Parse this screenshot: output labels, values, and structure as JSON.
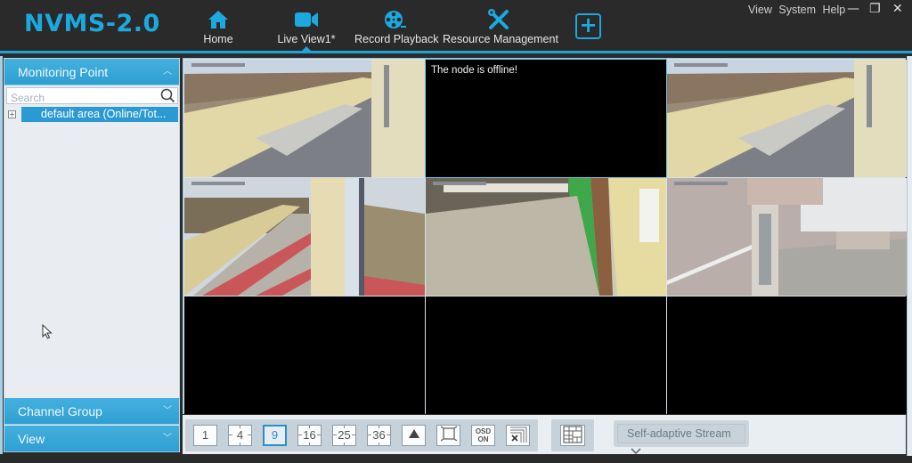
{
  "app": {
    "title": "NVMS-2.0",
    "accent_color": "#1ba9e0"
  },
  "nav": {
    "items": [
      {
        "label": "Home",
        "icon": "home-icon"
      },
      {
        "label": "Live View1*",
        "icon": "video-camera-icon",
        "active": true
      },
      {
        "label": "Record Playback",
        "icon": "film-reel-icon"
      },
      {
        "label": "Resource Management",
        "icon": "tools-icon"
      }
    ],
    "add_label": "+"
  },
  "system_menu": {
    "view": "View",
    "system": "System",
    "help": "Help",
    "minimize": "—",
    "restore": "❐",
    "close": "✕"
  },
  "sidebar": {
    "monitoring_point": "Monitoring Point",
    "search_placeholder": "Search",
    "tree": [
      {
        "label": "default area (Online/Tot...",
        "expand": "+"
      }
    ],
    "channel_group": "Channel Group",
    "view": "View"
  },
  "grid": {
    "layout": "3x3",
    "cells": [
      {
        "state": "video",
        "scene": "terrace"
      },
      {
        "state": "offline",
        "message": "The node is offline!"
      },
      {
        "state": "video",
        "scene": "terrace"
      },
      {
        "state": "video",
        "scene": "walkway"
      },
      {
        "state": "video",
        "scene": "hall"
      },
      {
        "state": "video",
        "scene": "building"
      },
      {
        "state": "empty"
      },
      {
        "state": "empty"
      },
      {
        "state": "empty"
      }
    ]
  },
  "toolbar": {
    "layouts": [
      "1",
      "4",
      "9",
      "16",
      "25",
      "36"
    ],
    "active_layout": "9",
    "osd_label_top": "OSD",
    "osd_label_bottom": "ON",
    "close_all": "×",
    "stream_select": "Self-adaptive Stream",
    "stream_chevron": "⌄"
  }
}
